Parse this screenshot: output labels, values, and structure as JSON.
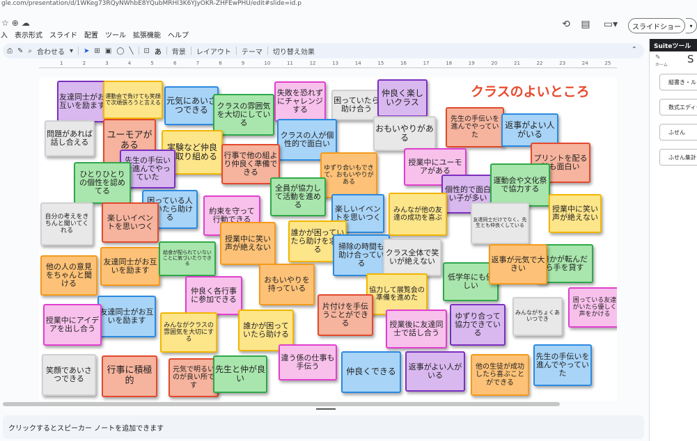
{
  "browser": {
    "url": "gle.com/presentation/d/1WKeg73RQyNWhbE8YQubMRHI3K6YJyOKR-ZHFEwPHU/edit#slide=id.p"
  },
  "app": {
    "menu": [
      "入",
      "表示形式",
      "スライド",
      "配置",
      "ツール",
      "拡張機能",
      "ヘルプ"
    ],
    "slideshow_label": "スライドショー",
    "toolbar": {
      "zoom": "合わせる",
      "background": "背景",
      "layout": "レイアウト",
      "theme": "テーマ",
      "transition": "切り替え効果"
    },
    "ruler_ticks": [
      "1",
      "2",
      "3",
      "4",
      "5",
      "6",
      "7",
      "8",
      "9",
      "10",
      "11",
      "12",
      "13",
      "14",
      "15",
      "16",
      "17",
      "18",
      "19",
      "20",
      "21",
      "22",
      "23",
      "24",
      "25"
    ],
    "speaker_notes_placeholder": "クリックするとスピーカー ノートを追加できます"
  },
  "side_panel": {
    "title": "Suiteツール",
    "logo": "ホーム",
    "letter": "S",
    "buttons": [
      "縦書き・ルビ",
      "数式エディタ",
      "ふせん",
      "ふせん集計"
    ]
  },
  "slide": {
    "title": "クラスのよいところ",
    "notes": [
      {
        "text": "友達同士がお互いを励ます",
        "color": "purple"
      },
      {
        "text": "運動会で負けても笑顔で次頑張ろうと言える",
        "color": "yellow"
      },
      {
        "text": "元気にあいさつできる",
        "color": "blue"
      },
      {
        "text": "クラスの雰囲気を大切にしている",
        "color": "green"
      },
      {
        "text": "失敗を恐れずにチャレンジする",
        "color": "pink"
      },
      {
        "text": "困っていたら助け合う",
        "color": "gray"
      },
      {
        "text": "仲良く楽しいクラス",
        "color": "purple"
      },
      {
        "text": "問題があれば話し合える",
        "color": "gray"
      },
      {
        "text": "ユーモアがある",
        "color": "red"
      },
      {
        "text": "クラスの人が個性的で面白い",
        "color": "blue"
      },
      {
        "text": "おもいやりがある",
        "color": "gray"
      },
      {
        "text": "先生の手伝いを進んでやっていた",
        "color": "red"
      },
      {
        "text": "返事がよい人がいる",
        "color": "blue"
      },
      {
        "text": "実験など仲良く取り組める",
        "color": "yellow"
      },
      {
        "text": "先生の手伝いを進んでやっていた",
        "color": "purple"
      },
      {
        "text": "行事で他の組より仲良く準備できる",
        "color": "red"
      },
      {
        "text": "ゆずり合いもできて、おもいやりがある",
        "color": "orange"
      },
      {
        "text": "プリントを配る時も面白い",
        "color": "red"
      },
      {
        "text": "ひとりひとりの個性を認めてる",
        "color": "green"
      },
      {
        "text": "授業中にユーモアがある",
        "color": "pink"
      },
      {
        "text": "個性的で面白い子が多い",
        "color": "purple"
      },
      {
        "text": "運動会や文化祭で協力する",
        "color": "green"
      },
      {
        "text": "全員が協力して活動を進める",
        "color": "green"
      },
      {
        "text": "困っている人がいたら助ける",
        "color": "blue"
      },
      {
        "text": "約束を守って行動できる",
        "color": "pink"
      },
      {
        "text": "楽しいイベントを思いつく",
        "color": "blue"
      },
      {
        "text": "みんなが他の友達の成功を喜ぶ",
        "color": "yellow"
      },
      {
        "text": "授業中に笑い声が絶えない",
        "color": "orange"
      },
      {
        "text": "自分の考えをきちんと聞いてくれる",
        "color": "gray"
      },
      {
        "text": "楽しいイベントを思いつく",
        "color": "red"
      },
      {
        "text": "友達同士だけでなく、先生とも仲良くしている",
        "color": "gray"
      },
      {
        "text": "授業中に笑い声が絶えない",
        "color": "yellow"
      },
      {
        "text": "誰かが困っていたら助けを求める",
        "color": "yellow"
      },
      {
        "text": "掃除の時間も助け合っている",
        "color": "blue"
      },
      {
        "text": "クラス全体で笑いが絶えない",
        "color": "gray"
      },
      {
        "text": "友達同士がお互いを励ます",
        "color": "orange"
      },
      {
        "text": "給食が配られていないことに気づいたりできる",
        "color": "green"
      },
      {
        "text": "誰かが転んだら手を貸す",
        "color": "green"
      },
      {
        "text": "他の人の意見をちゃんと聞ける",
        "color": "orange"
      },
      {
        "text": "低学年にも優しい",
        "color": "green"
      },
      {
        "text": "返事が元気で大きい",
        "color": "orange"
      },
      {
        "text": "おもいやりを持っている",
        "color": "orange"
      },
      {
        "text": "仲良く各行事に参加できる",
        "color": "pink"
      },
      {
        "text": "協力して展覧会の準備を進めた",
        "color": "yellow"
      },
      {
        "text": "困っている友達がいたら優しく声をかける",
        "color": "pink"
      },
      {
        "text": "友達同士がお互いを励ます",
        "color": "blue"
      },
      {
        "text": "片付けを手伝うことができる",
        "color": "red"
      },
      {
        "text": "みんながちょくあいつでき",
        "color": "gray"
      },
      {
        "text": "授業中にアイデアを出し合う",
        "color": "pink"
      },
      {
        "text": "ゆずり合って協力できている",
        "color": "purple"
      },
      {
        "text": "授業後に友達同士で話し合う",
        "color": "pink"
      },
      {
        "text": "みんながクラスの雰囲気を大切にする",
        "color": "yellow"
      },
      {
        "text": "誰かが困っていたら助ける",
        "color": "yellow"
      },
      {
        "text": "違う係の仕事も手伝う",
        "color": "pink"
      },
      {
        "text": "先生の手伝いを進んでやっていた",
        "color": "blue"
      },
      {
        "text": "笑顔であいさつできる",
        "color": "gray"
      },
      {
        "text": "行事に積極的",
        "color": "red"
      },
      {
        "text": "元気で明るいのが良い所です",
        "color": "red"
      },
      {
        "text": "先生と仲が良い",
        "color": "green"
      },
      {
        "text": "仲良くできる",
        "color": "blue"
      },
      {
        "text": "返事がよい人がいる",
        "color": "purple"
      },
      {
        "text": "他の生徒が成功したら喜ぶことができる",
        "color": "orange"
      }
    ]
  }
}
